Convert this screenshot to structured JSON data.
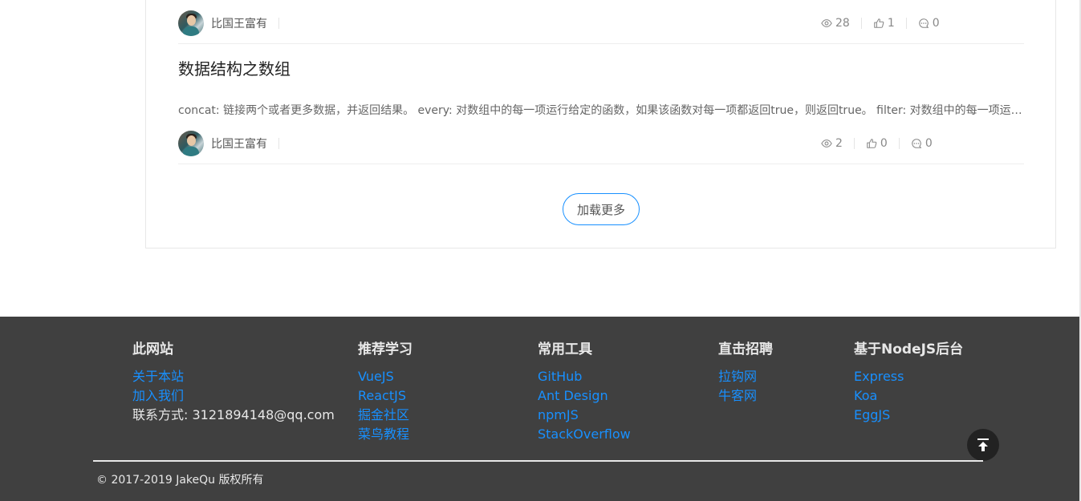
{
  "articles": [
    {
      "author": "比国王富有",
      "views": "28",
      "likes": "1",
      "comments": "0"
    },
    {
      "title": "数据结构之数组",
      "summary": "concat: 链接两个或者更多数据，并返回结果。 every: 对数组中的每一项运行给定的函数，如果该函数对每一项都返回true，则返回true。 filter: 对数组中的每一项运行给定的函数，返回该函数会返回true的项组成的数组。",
      "author": "比国王富有",
      "views": "2",
      "likes": "0",
      "comments": "0"
    }
  ],
  "load_more_label": "加载更多",
  "icons": {
    "views": "eye-icon",
    "likes": "thumbs-up-icon",
    "comments": "comment-icon",
    "back_to_top": "arrow-up-to-line-icon"
  },
  "footer": {
    "columns": [
      {
        "title": "此网站",
        "links": [
          "关于本站",
          "加入我们"
        ],
        "text": "联系方式: 3121894148@qq.com"
      },
      {
        "title": "推荐学习",
        "links": [
          "VueJS",
          "ReactJS",
          "掘金社区",
          "菜鸟教程"
        ]
      },
      {
        "title": "常用工具",
        "links": [
          "GitHub",
          "Ant Design",
          "npmJS",
          "StackOverflow"
        ]
      },
      {
        "title": "直击招聘",
        "links": [
          "拉钩网",
          "牛客网"
        ]
      },
      {
        "title": "基于NodeJS后台",
        "links": [
          "Express",
          "Koa",
          "EggJS"
        ]
      }
    ],
    "copyright": "© 2017-2019 JakeQu 版权所有"
  },
  "colors": {
    "accent": "#1890ff",
    "footer_bg": "#404040",
    "footer_text": "#e8e8e8"
  }
}
